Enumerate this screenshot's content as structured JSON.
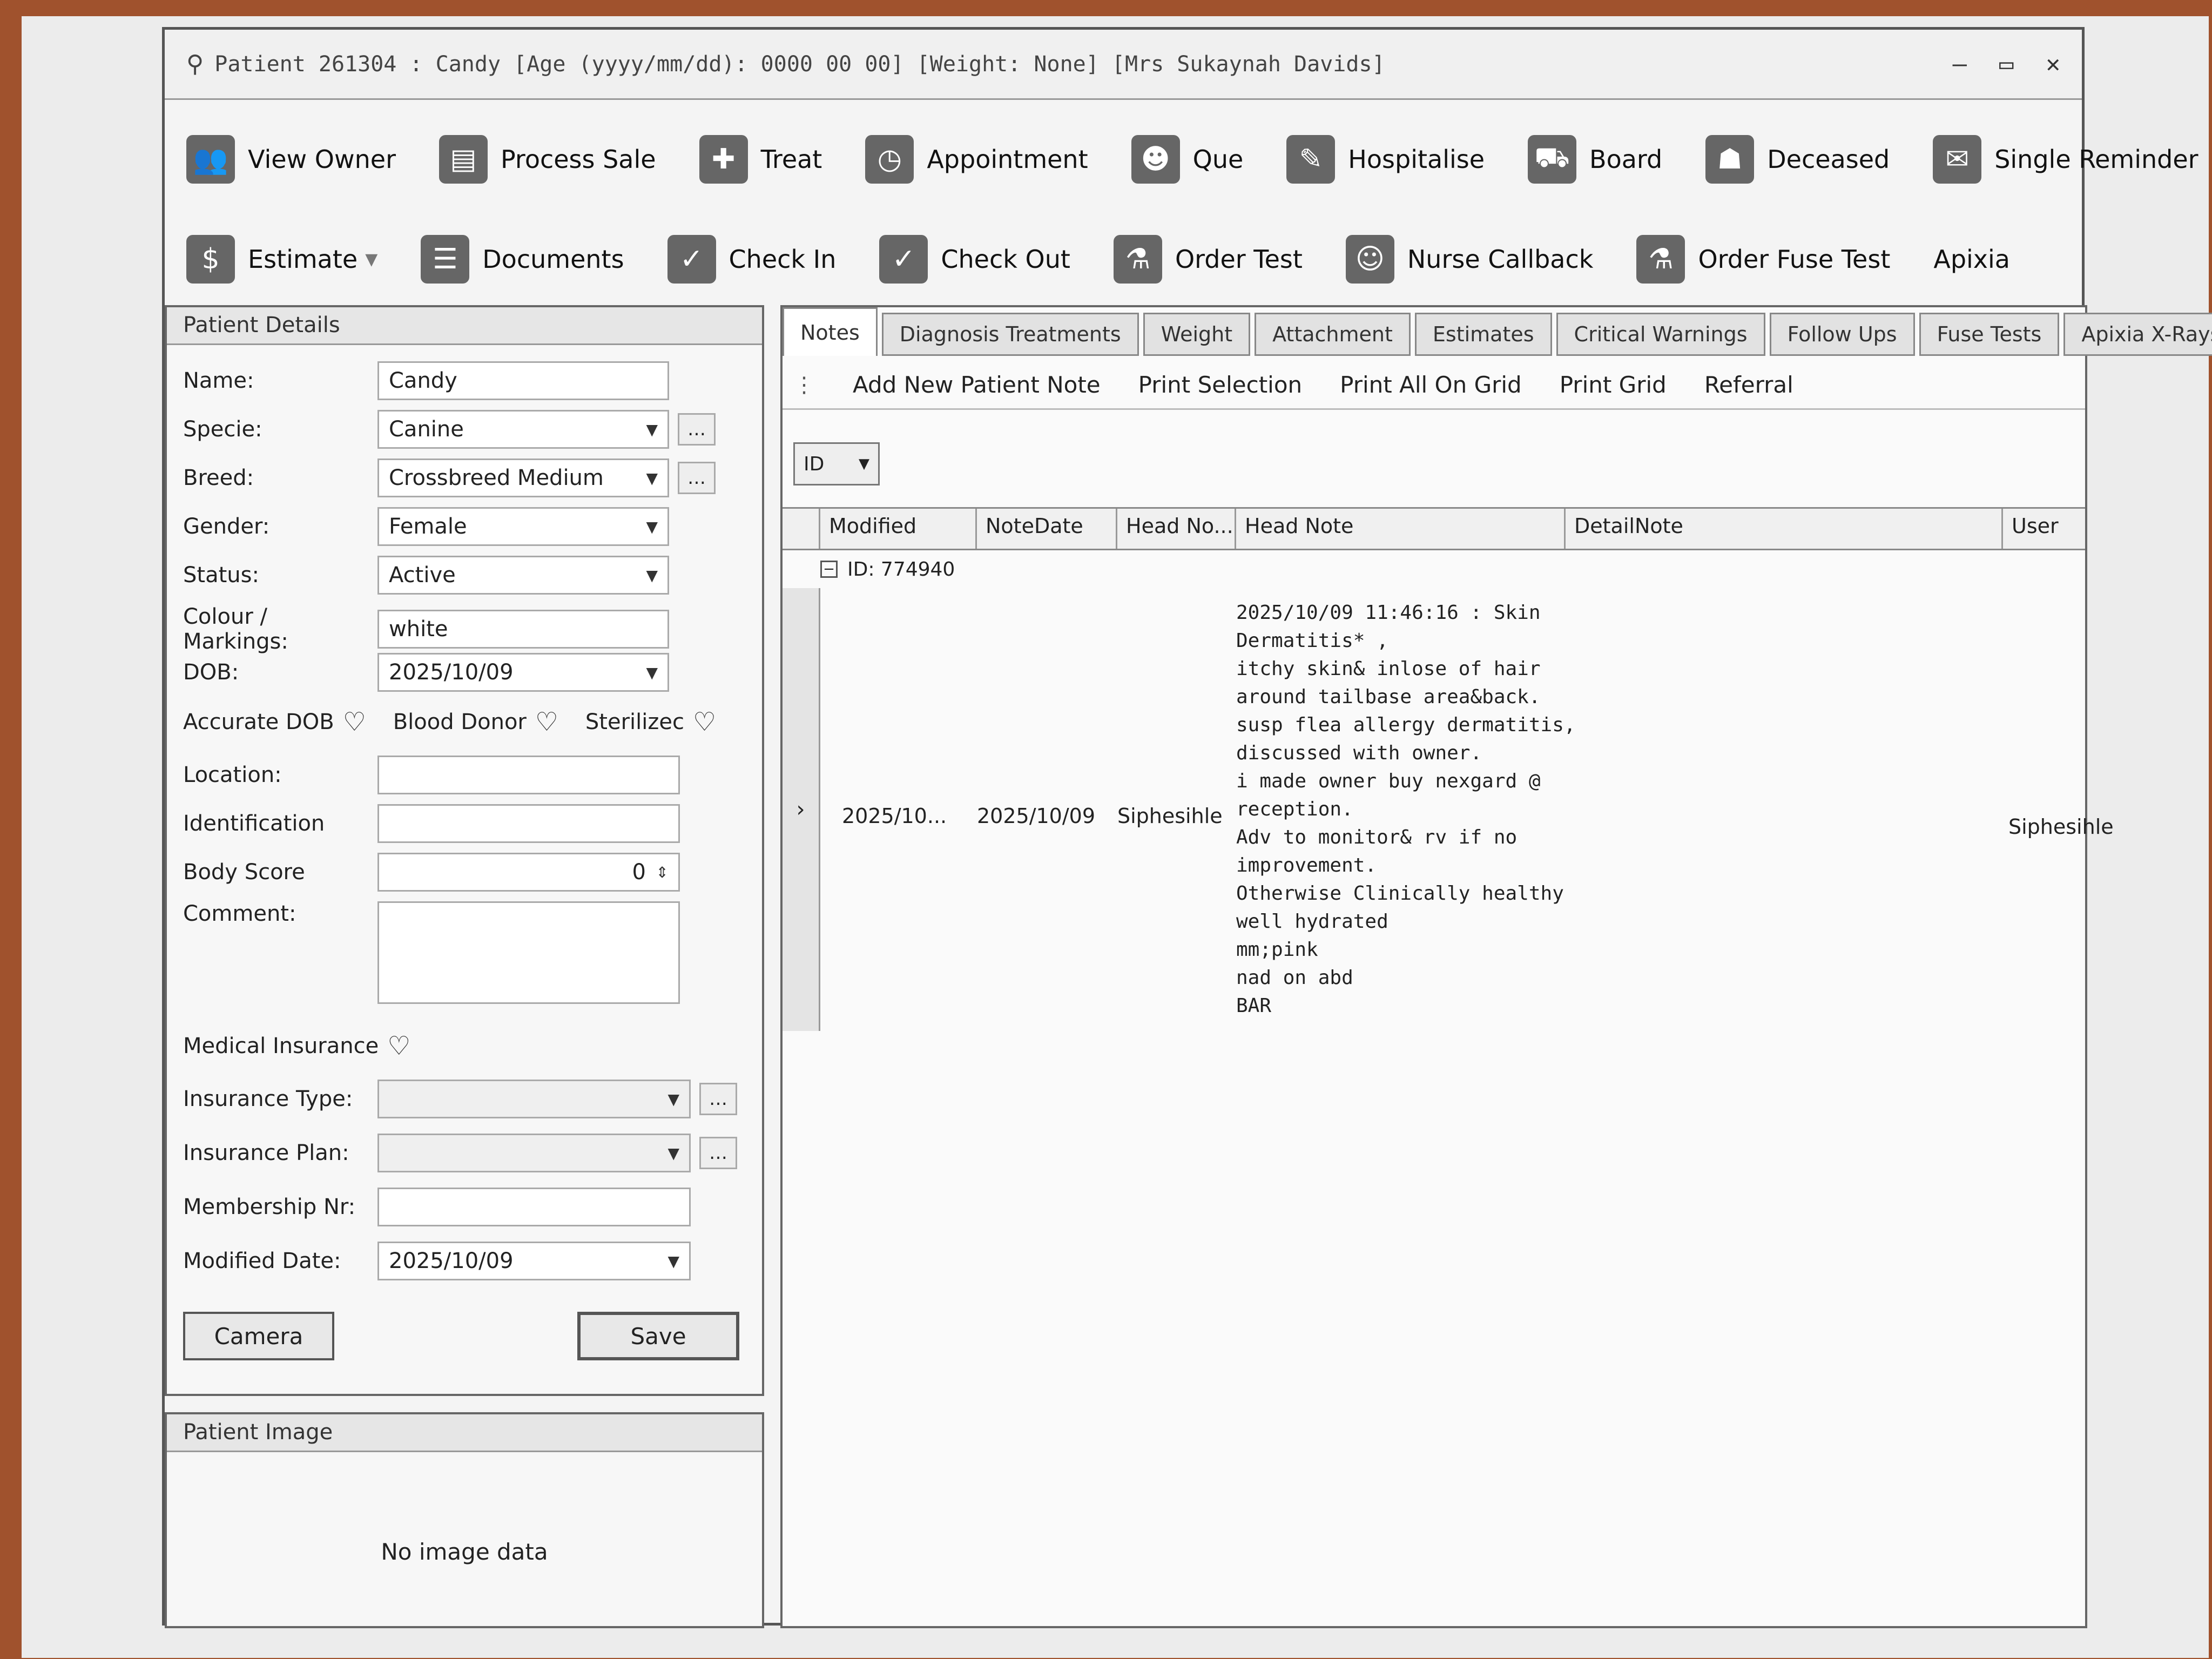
{
  "window": {
    "title": "Patient 261304 : Candy  [Age (yyyy/mm/dd): 0000 00 00]  [Weight: None]  [Mrs Sukaynah Davids]"
  },
  "toolbar_row1": [
    {
      "label": "View Owner",
      "icon": "owner-icon"
    },
    {
      "label": "Process Sale",
      "icon": "cash-register-icon"
    },
    {
      "label": "Treat",
      "icon": "doctor-icon"
    },
    {
      "label": "Appointment",
      "icon": "clock-icon"
    },
    {
      "label": "Que",
      "icon": "people-icon"
    },
    {
      "label": "Hospitalise",
      "icon": "bandage-icon"
    },
    {
      "label": "Board",
      "icon": "car-icon"
    },
    {
      "label": "Deceased",
      "icon": "person-icon"
    },
    {
      "label": "Single Reminder",
      "icon": "message-icon"
    }
  ],
  "toolbar_row2": [
    {
      "label": "Estimate",
      "icon": "calculator-icon"
    },
    {
      "label": "Documents",
      "icon": "document-icon"
    },
    {
      "label": "Check In",
      "icon": "check-in-icon"
    },
    {
      "label": "Check Out",
      "icon": "check-out-icon"
    },
    {
      "label": "Order Test",
      "icon": "flask-icon"
    },
    {
      "label": "Nurse Callback",
      "icon": "nurse-icon"
    },
    {
      "label": "Order Fuse Test",
      "icon": "flask-icon"
    },
    {
      "label": "Apixia",
      "icon": ""
    }
  ],
  "patient_details": {
    "header": "Patient Details",
    "name_label": "Name:",
    "name": "Candy",
    "specie_label": "Specie:",
    "specie": "Canine",
    "breed_label": "Breed:",
    "breed": "Crossbreed Medium",
    "gender_label": "Gender:",
    "gender": "Female",
    "status_label": "Status:",
    "status": "Active",
    "colour_label": "Colour / Markings:",
    "colour": "white",
    "dob_label": "DOB:",
    "dob": "2025/10/09",
    "accurate_dob": "Accurate DOB",
    "blood_donor": "Blood Donor",
    "sterilized": "Sterilizec",
    "location_label": "Location:",
    "identification_label": "Identification",
    "body_score_label": "Body Score",
    "body_score": "0",
    "comment_label": "Comment:",
    "medical_insurance": "Medical Insurance",
    "insurance_type_label": "Insurance Type:",
    "insurance_plan_label": "Insurance Plan:",
    "membership_label": "Membership Nr:",
    "modified_date_label": "Modified Date:",
    "modified_date": "2025/10/09",
    "camera_button": "Camera",
    "save_button": "Save"
  },
  "patient_image": {
    "header": "Patient Image",
    "empty_text": "No image data"
  },
  "tabs": [
    "Notes",
    "Diagnosis Treatments",
    "Weight",
    "Attachment",
    "Estimates",
    "Critical Warnings",
    "Follow Ups",
    "Fuse Tests",
    "Apixia X-Rays"
  ],
  "notes_actions": [
    "Add New Patient Note",
    "Print Selection",
    "Print All On Grid",
    "Print Grid",
    "Referral"
  ],
  "group_by": "ID",
  "grid": {
    "columns": [
      "Modified",
      "NoteDate",
      "Head No...",
      "Head Note",
      "DetailNote",
      "User"
    ],
    "group_label": "ID: 774940",
    "row": {
      "modified": "2025/10...",
      "note_date": "2025/10/09",
      "head_no": "Siphesihle",
      "head_note_lines": [
        "2025/10/09 11:46:16 : Skin",
        "Dermatitis* ,",
        "itchy skin& inlose of hair",
        "around tailbase area&back.",
        "susp flea allergy dermatitis,",
        "discussed with owner.",
        "i made owner buy nexgard @",
        "reception.",
        "Adv to monitor& rv if no",
        "improvement.",
        "Otherwise Clinically healthy",
        "well hydrated",
        "mm;pink",
        "nad on abd",
        "BAR"
      ],
      "detail_note": "",
      "user": "Siphesihle"
    }
  }
}
